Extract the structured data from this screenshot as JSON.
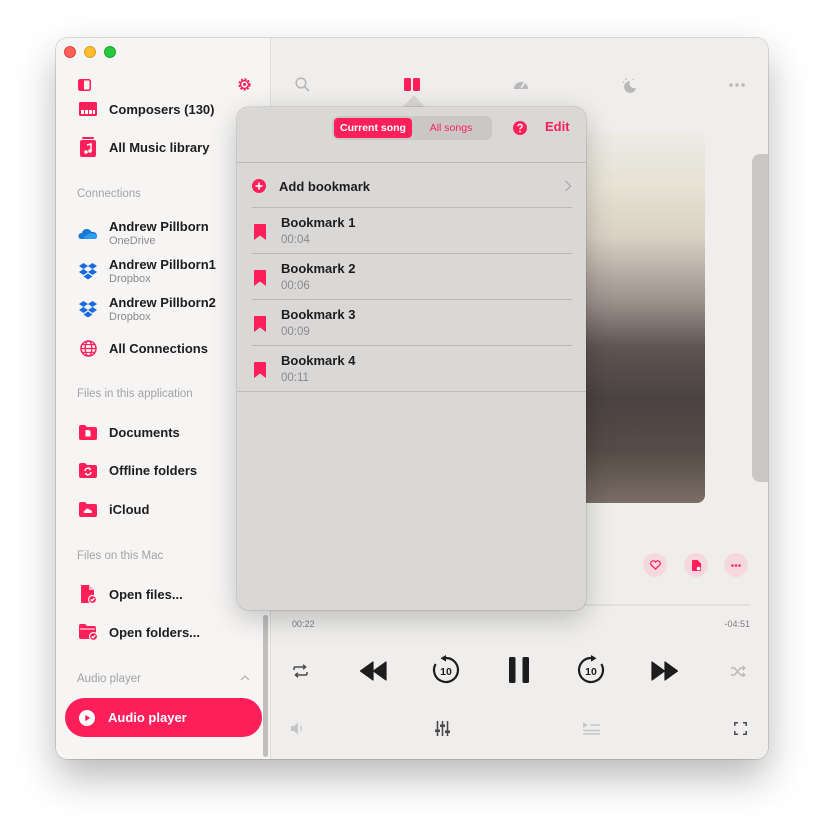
{
  "colors": {
    "accent": "#fd1f5a",
    "popover_bg": "#d9d8d6",
    "sidebar_bg": "#f6f5f4"
  },
  "sidebar": {
    "library_items": [
      {
        "label": "Composers (130)",
        "icon": "piano-icon"
      },
      {
        "label": "All Music library",
        "icon": "music-library-icon"
      }
    ],
    "connections_header": "Connections",
    "connections": [
      {
        "label": "Andrew Pillborn",
        "sub": "OneDrive",
        "icon": "onedrive-icon"
      },
      {
        "label": "Andrew Pillborn1",
        "sub": "Dropbox",
        "icon": "dropbox-icon"
      },
      {
        "label": "Andrew Pillborn2",
        "sub": "Dropbox",
        "icon": "dropbox-icon"
      },
      {
        "label": "All Connections",
        "icon": "globe-icon"
      }
    ],
    "files_app_header": "Files in this application",
    "files_app": [
      {
        "label": "Documents",
        "icon": "folder-documents-icon"
      },
      {
        "label": "Offline folders",
        "icon": "folder-sync-icon"
      },
      {
        "label": "iCloud",
        "icon": "folder-icloud-icon"
      }
    ],
    "files_mac_header": "Files on this Mac",
    "files_mac": [
      {
        "label": "Open files...",
        "icon": "open-file-icon"
      },
      {
        "label": "Open folders...",
        "icon": "open-folder-icon"
      }
    ],
    "audio_header": "Audio player",
    "audio_button": "Audio player"
  },
  "player": {
    "elapsed": "00:22",
    "remaining": "-04:51",
    "progress": 0.07
  },
  "popover": {
    "segment": {
      "current": "Current song",
      "all": "All songs",
      "selected": "Current song"
    },
    "edit": "Edit",
    "add_bookmark": "Add bookmark",
    "bookmarks": [
      {
        "title": "Bookmark 1",
        "time": "00:04"
      },
      {
        "title": "Bookmark 2",
        "time": "00:06"
      },
      {
        "title": "Bookmark 3",
        "time": "00:09"
      },
      {
        "title": "Bookmark 4",
        "time": "00:11"
      }
    ]
  }
}
